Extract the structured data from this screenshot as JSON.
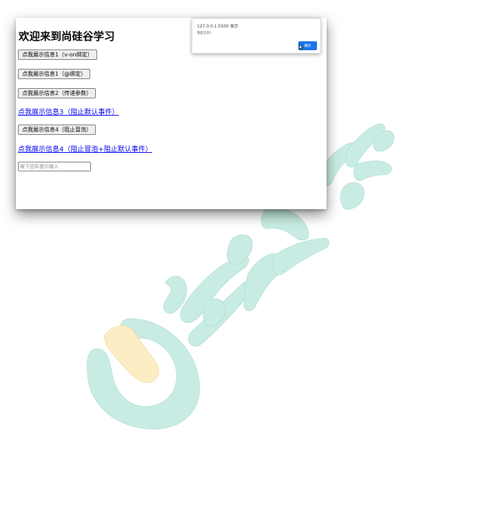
{
  "page": {
    "title": "欢迎来到尚硅谷学习",
    "buttons": [
      "点我展示信息1（v-on绑定）",
      "点我展示信息1（@绑定）",
      "点我展示信息2（传递参数）",
      "点我展示信息4（阻止冒泡）"
    ],
    "links": [
      "点我展示信息3（阻止默认事件）",
      "点我展示信息4（阻止冒泡+阻止默认事件）"
    ],
    "input_placeholder": "敲下回车提示输入"
  },
  "dialog": {
    "origin": "127.0.0.1:5500 显示",
    "message": "我是信息1",
    "ok_label": "确定"
  },
  "watermark": {
    "teal": "#c8ece3",
    "yellow": "#fdedc5"
  },
  "icons": [
    "mouse-cursor-icon",
    "watermark-logo-icon"
  ]
}
